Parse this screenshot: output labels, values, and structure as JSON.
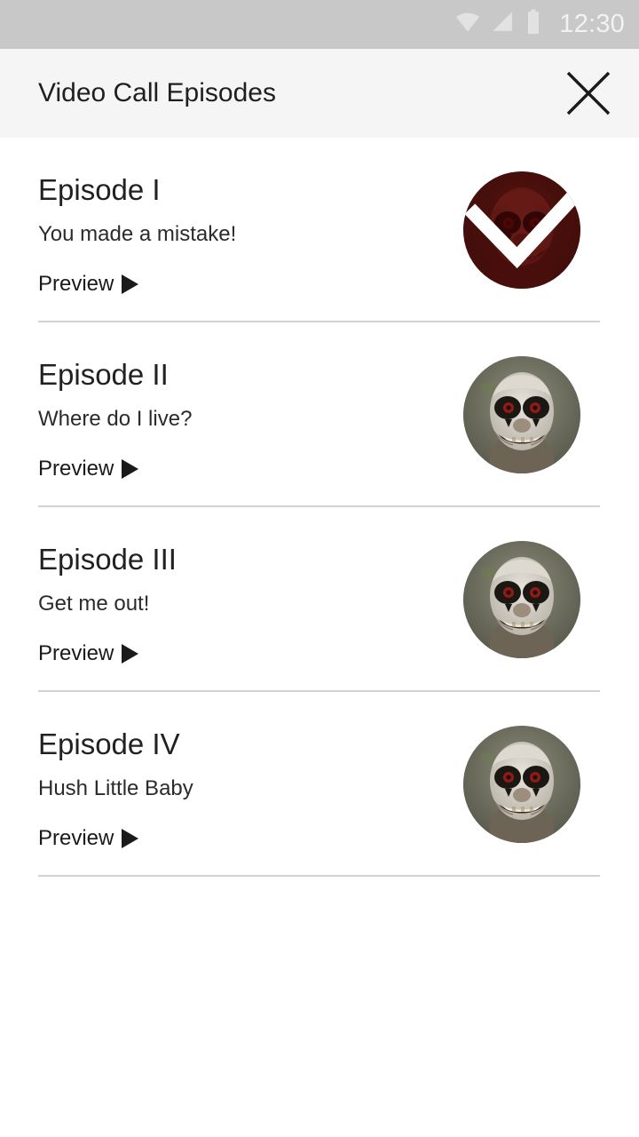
{
  "status_bar": {
    "time": "12:30",
    "icons": [
      "wifi-icon",
      "signal-icon",
      "battery-icon"
    ],
    "background_color": "#c8c8c8",
    "foreground_color": "#f2f2f2"
  },
  "toolbar": {
    "title": "Video Call Episodes",
    "close_label": "close-icon",
    "background_color": "#f5f5f5",
    "title_color": "#1f1f1f"
  },
  "episodes": [
    {
      "title": "Episode I",
      "subtitle": "You made a mistake!",
      "preview_label": "Preview",
      "avatar": "clown-face-avatar",
      "unlocked": true,
      "tint_color": "#8c1f19"
    },
    {
      "title": "Episode II",
      "subtitle": "Where do I live?",
      "preview_label": "Preview",
      "avatar": "clown-face-avatar",
      "unlocked": false,
      "tint_color": ""
    },
    {
      "title": "Episode III",
      "subtitle": "Get me out!",
      "preview_label": "Preview",
      "avatar": "clown-face-avatar",
      "unlocked": false,
      "tint_color": ""
    },
    {
      "title": "Episode IV",
      "subtitle": "Hush Little Baby",
      "preview_label": "Preview",
      "avatar": "clown-face-avatar",
      "unlocked": false,
      "tint_color": ""
    }
  ],
  "colors": {
    "page_background": "#ffffff",
    "divider": "#d2d2d2",
    "text_primary": "#212121",
    "text_secondary": "#2b2b2b"
  }
}
